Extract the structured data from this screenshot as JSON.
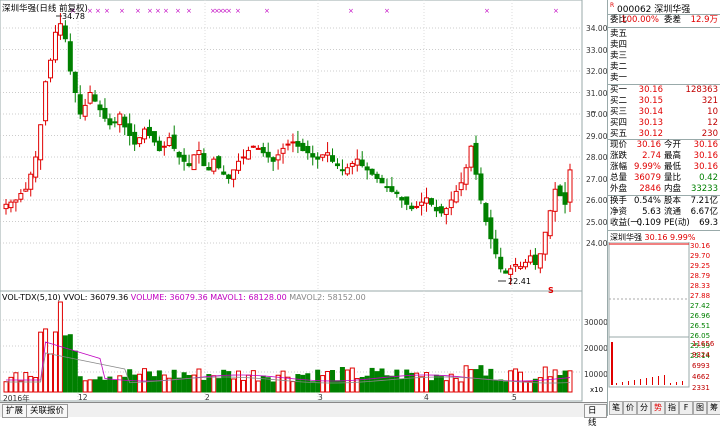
{
  "header": {
    "title": "深圳华强(日线 前复权)",
    "high_marker": "34.78",
    "low_marker": "22.41",
    "s_marker": "S"
  },
  "price_axis": [
    "34.00",
    "33.00",
    "32.00",
    "31.00",
    "30.00",
    "29.00",
    "28.00",
    "27.00",
    "26.00",
    "25.00",
    "24.00"
  ],
  "volume_header": {
    "indicator": "VOL-TDX(5,10)",
    "vvol": "VVOL: 36079.36",
    "volume": "VOLUME: 36079.36",
    "mavol1": "MAVOL1: 68128.00",
    "mavol2": "MAVOL2: 58152.00"
  },
  "volume_axis": [
    "30000",
    "20000",
    "10000"
  ],
  "volume_unit": "x10",
  "date_labels": [
    "2016年",
    "12",
    "2",
    "3",
    "4",
    "5"
  ],
  "bottom_tabs": [
    "扩展",
    "关联报价"
  ],
  "day_tab": "日线",
  "quote": {
    "code": "000062",
    "name": "深圳华强",
    "weibi_label": "委比",
    "weibi": "100.00%",
    "weicha_label": "委差",
    "weicha": "12.9万",
    "sells": [
      {
        "label": "卖五",
        "price": "",
        "vol": ""
      },
      {
        "label": "卖四",
        "price": "",
        "vol": ""
      },
      {
        "label": "卖三",
        "price": "",
        "vol": ""
      },
      {
        "label": "卖二",
        "price": "",
        "vol": ""
      },
      {
        "label": "卖一",
        "price": "",
        "vol": ""
      }
    ],
    "buys": [
      {
        "label": "买一",
        "price": "30.16",
        "vol": "128363"
      },
      {
        "label": "买二",
        "price": "30.15",
        "vol": "321"
      },
      {
        "label": "买三",
        "price": "30.14",
        "vol": "10"
      },
      {
        "label": "买四",
        "price": "30.13",
        "vol": "12"
      },
      {
        "label": "买五",
        "price": "30.12",
        "vol": "230"
      }
    ],
    "stats": [
      {
        "l1": "现价",
        "v1": "30.16",
        "l2": "今开",
        "v2": "30.16"
      },
      {
        "l1": "涨跌",
        "v1": "2.74",
        "l2": "最高",
        "v2": "30.16"
      },
      {
        "l1": "涨幅",
        "v1": "9.99%",
        "l2": "最低",
        "v2": "30.16"
      },
      {
        "l1": "总量",
        "v1": "36079",
        "l2": "量比",
        "v2": "0.42"
      },
      {
        "l1": "外盘",
        "v1": "2846",
        "l2": "内盘",
        "v2": "33233"
      }
    ],
    "stats2": [
      {
        "l1": "换手",
        "v1": "0.54%",
        "l2": "股本",
        "v2": "7.21亿"
      },
      {
        "l1": "净资",
        "v1": "5.63",
        "l2": "流通",
        "v2": "6.67亿"
      },
      {
        "l1": "收益(一)",
        "v1": "0.109",
        "l2": "PE(动)",
        "v2": "69.3"
      }
    ],
    "mini_title": "深圳华强",
    "mini_price": "30.16",
    "mini_pct": "9.99%",
    "mini_axis": [
      "30.16",
      "29.70",
      "29.25",
      "28.79",
      "28.33",
      "27.88",
      "27.42",
      "26.96",
      "26.51",
      "26.05",
      "25.59",
      "25.14"
    ],
    "mini_vol_axis": [
      "11656",
      "9324",
      "6993",
      "4662",
      "2331"
    ],
    "bottom_icons": [
      "笔",
      "价",
      "分",
      "势",
      "指",
      "F",
      "图",
      "筹"
    ]
  }
}
